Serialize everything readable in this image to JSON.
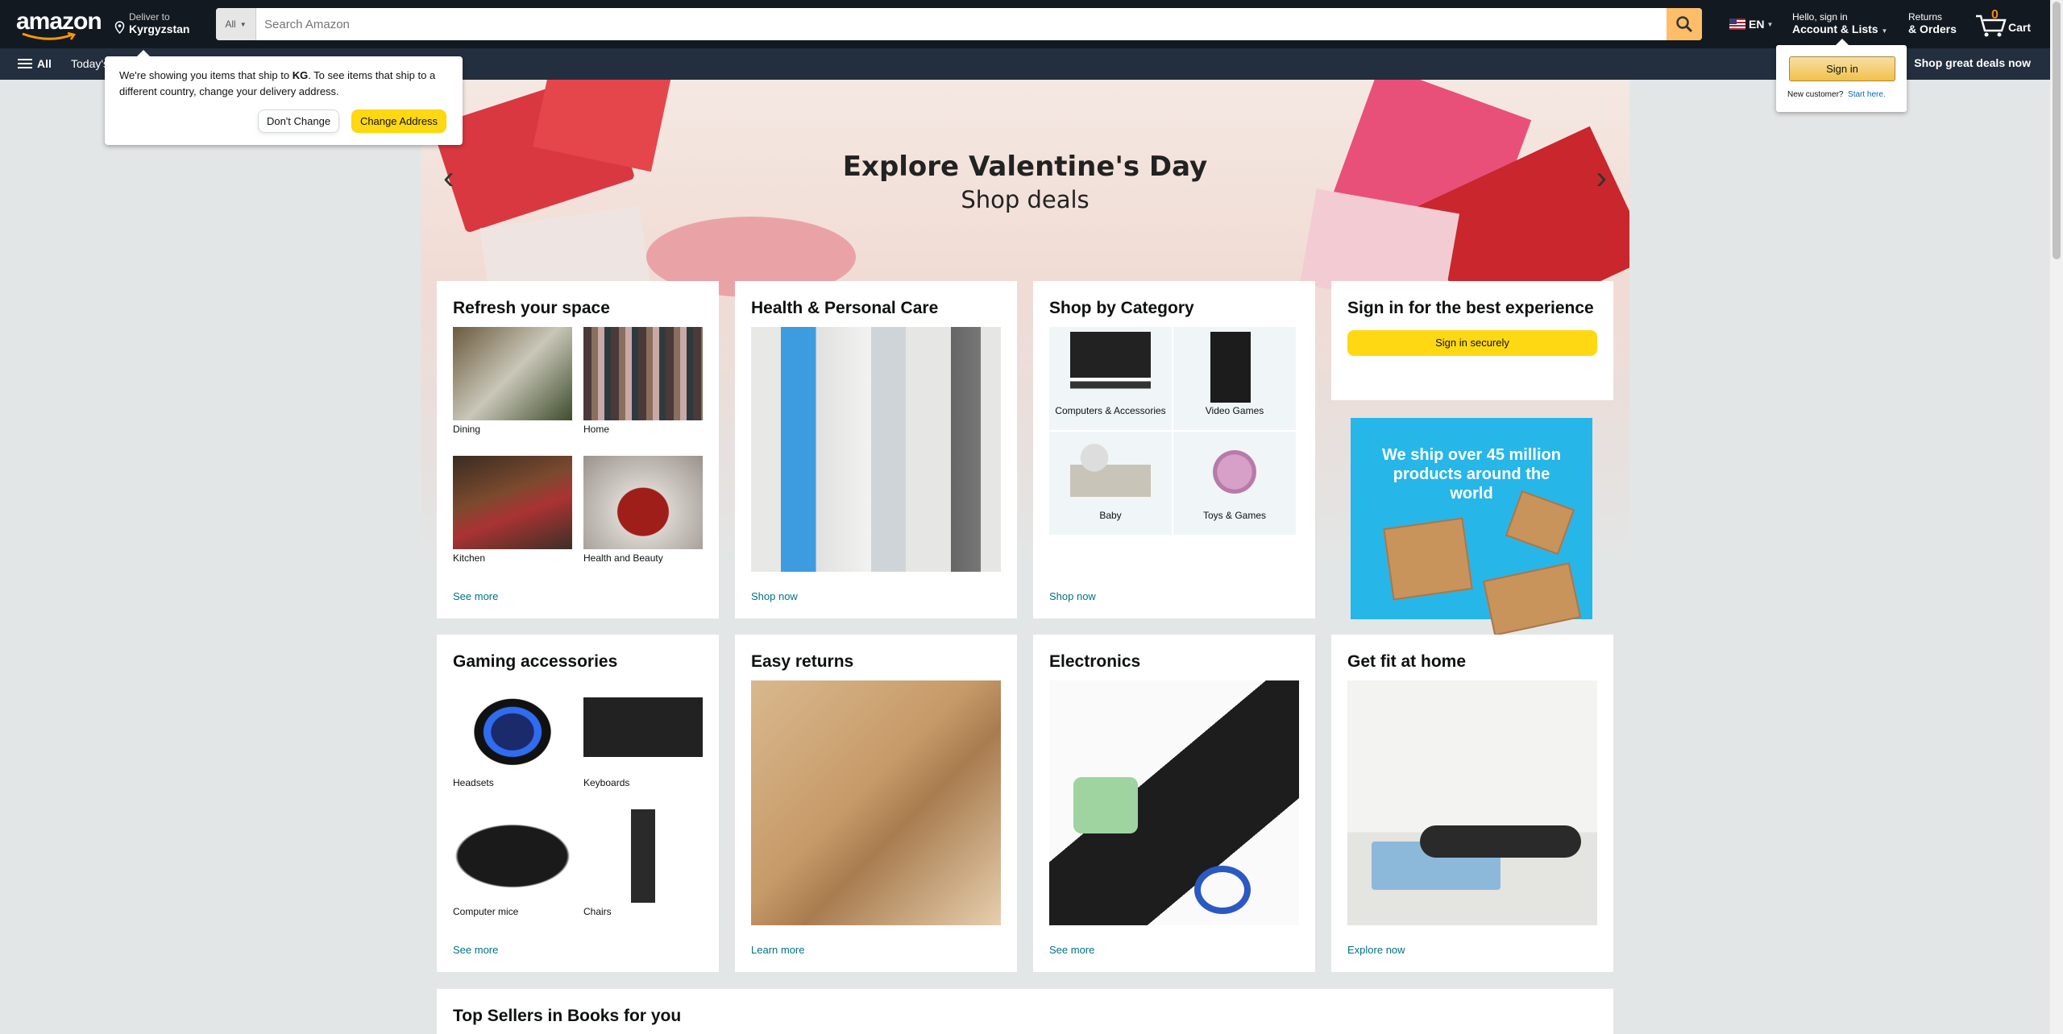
{
  "header": {
    "deliver_line1": "Deliver to",
    "deliver_line2": "Kyrgyzstan",
    "search_category": "All",
    "search_placeholder": "Search Amazon",
    "language": "EN",
    "account_line1": "Hello, sign in",
    "account_line2": "Account & Lists",
    "returns_line1": "Returns",
    "returns_line2": "& Orders",
    "cart_count": "0",
    "cart_label": "Cart"
  },
  "subnav": {
    "all_label": "All",
    "today_label": "Today's",
    "promo": "Shop great deals now"
  },
  "popover": {
    "text_pre": "We're showing you items that ship to ",
    "country_code": "KG",
    "text_post": ". To see items that ship to a different country, change your delivery address.",
    "dont_change": "Don't Change",
    "change_address": "Change Address"
  },
  "signin_popover": {
    "button": "Sign in",
    "new_customer": "New customer?",
    "start_here": "Start here."
  },
  "hero": {
    "title": "Explore Valentine's Day",
    "subtitle": "Shop deals"
  },
  "cards": {
    "refresh": {
      "title": "Refresh your space",
      "items": [
        "Dining",
        "Home",
        "Kitchen",
        "Health and Beauty"
      ],
      "link": "See more"
    },
    "health": {
      "title": "Health & Personal Care",
      "link": "Shop now"
    },
    "category": {
      "title": "Shop by Category",
      "items": [
        "Computers & Accessories",
        "Video Games",
        "Baby",
        "Toys & Games"
      ],
      "link": "Shop now"
    },
    "signin": {
      "title": "Sign in for the best experience",
      "button": "Sign in securely"
    },
    "ship_ad": "We ship over 45 million products around the world",
    "gaming": {
      "title": "Gaming accessories",
      "items": [
        "Headsets",
        "Keyboards",
        "Computer mice",
        "Chairs"
      ],
      "link": "See more"
    },
    "returns": {
      "title": "Easy returns",
      "link": "Learn more"
    },
    "electronics": {
      "title": "Electronics",
      "link": "See more"
    },
    "fit": {
      "title": "Get fit at home",
      "link": "Explore now"
    }
  },
  "books": {
    "title": "Top Sellers in Books for you"
  },
  "colors": {
    "nav_bg": "#131921",
    "subnav_bg": "#232f3e",
    "accent": "#febd69",
    "button_yellow": "#ffd814",
    "link": "#007185",
    "cart_orange": "#f08804"
  }
}
